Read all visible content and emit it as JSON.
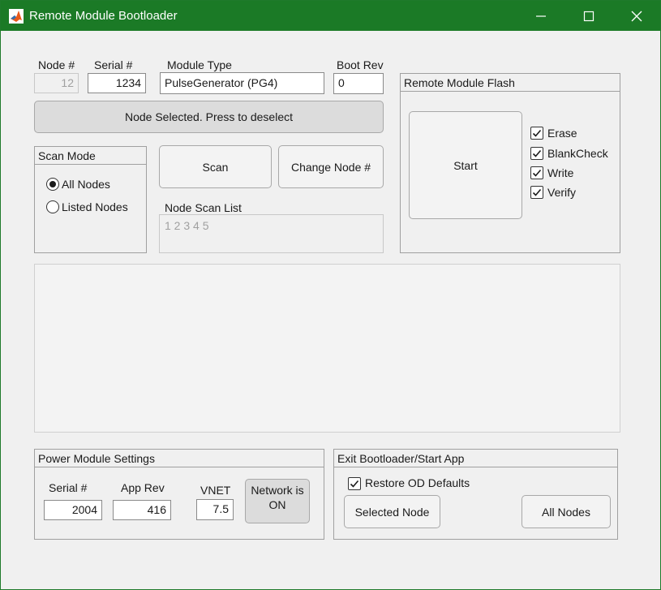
{
  "window": {
    "title": "Remote Module Bootloader"
  },
  "node": {
    "node_label": "Node #",
    "node_value": "12",
    "serial_label": "Serial #",
    "serial_value": "1234",
    "module_type_label": "Module Type",
    "module_type_value": "PulseGenerator (PG4)",
    "boot_rev_label": "Boot Rev",
    "boot_rev_value": "0",
    "select_button": "Node Selected. Press to deselect"
  },
  "scan_mode": {
    "title": "Scan Mode",
    "options": [
      {
        "label": "All Nodes",
        "selected": true
      },
      {
        "label": "Listed Nodes",
        "selected": false
      }
    ]
  },
  "actions": {
    "scan_button": "Scan",
    "change_node_button": "Change Node #"
  },
  "scan_list": {
    "label": "Node Scan List",
    "placeholder": "1 2 3 4 5"
  },
  "flash": {
    "title": "Remote Module Flash",
    "start_button": "Start",
    "options": [
      {
        "label": "Erase",
        "checked": true
      },
      {
        "label": "BlankCheck",
        "checked": true
      },
      {
        "label": "Write",
        "checked": true
      },
      {
        "label": "Verify",
        "checked": true
      }
    ]
  },
  "log": {
    "text": ""
  },
  "power": {
    "title": "Power Module Settings",
    "serial_label": "Serial #",
    "serial_value": "2004",
    "app_rev_label": "App Rev",
    "app_rev_value": "416",
    "vnet_label": "VNET",
    "vnet_value": "7.5",
    "network_button": "Network is ON"
  },
  "exit": {
    "title": "Exit Bootloader/Start App",
    "restore_label": "Restore OD Defaults",
    "restore_checked": true,
    "selected_node_button": "Selected Node",
    "all_nodes_button": "All Nodes"
  },
  "colors": {
    "titlebar": "#1b7a26",
    "window_bg": "#f0f0f0"
  },
  "icons": {
    "app": "matlab-icon",
    "minimize": "minimize-icon",
    "maximize": "maximize-icon",
    "close": "close-icon",
    "check": "checkmark-icon"
  }
}
